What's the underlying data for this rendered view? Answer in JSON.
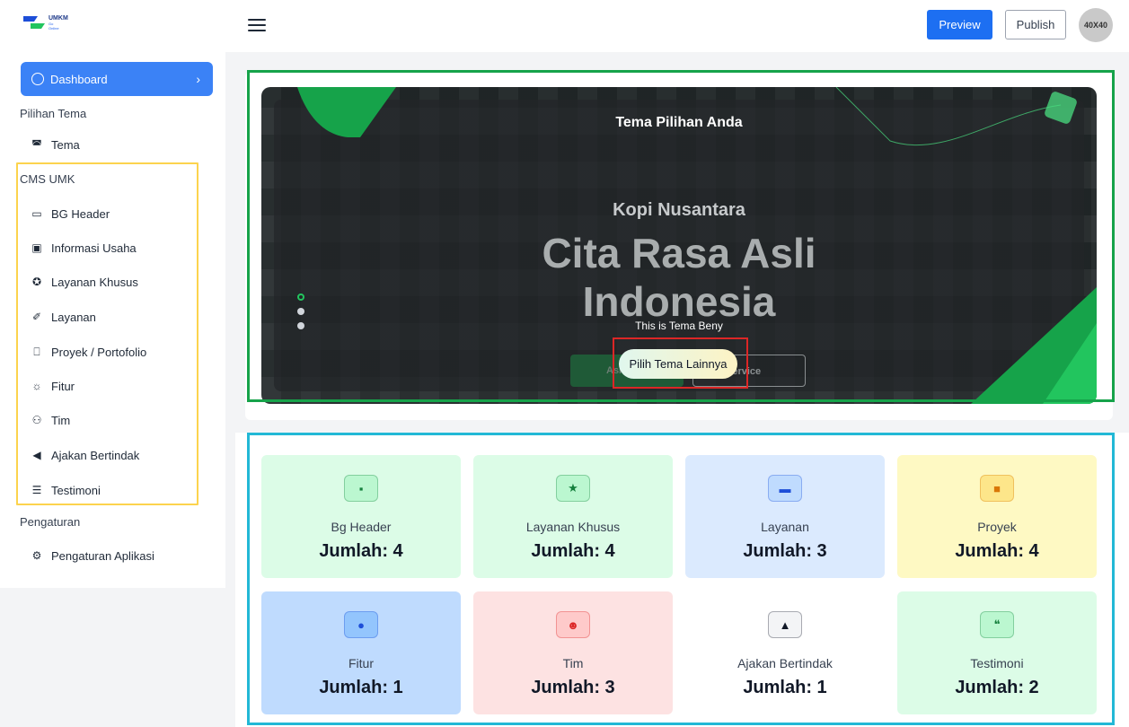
{
  "header": {
    "logo": {
      "line1": "UMKM",
      "line2": "Go",
      "line3": "Online"
    },
    "preview_label": "Preview",
    "publish_label": "Publish",
    "avatar_label": "40X40"
  },
  "sidebar": {
    "dashboard_label": "Dashboard",
    "sections": {
      "pilihan_tema": "Pilihan Tema",
      "cms_umk": "CMS UMK",
      "pengaturan": "Pengaturan"
    },
    "items": [
      {
        "label": "Tema",
        "icon": "palette-icon"
      },
      {
        "label": "BG Header",
        "icon": "image-icon"
      },
      {
        "label": "Informasi Usaha",
        "icon": "info-box-icon"
      },
      {
        "label": "Layanan Khusus",
        "icon": "star-circle-icon"
      },
      {
        "label": "Layanan",
        "icon": "handshake-icon"
      },
      {
        "label": "Proyek / Portofolio",
        "icon": "briefcase-icon"
      },
      {
        "label": "Fitur",
        "icon": "bulb-icon"
      },
      {
        "label": "Tim",
        "icon": "users-icon"
      },
      {
        "label": "Ajakan Bertindak",
        "icon": "megaphone-icon"
      },
      {
        "label": "Testimoni",
        "icon": "chat-icon"
      },
      {
        "label": "Pengaturan Aplikasi",
        "icon": "gear-icon"
      }
    ]
  },
  "hero": {
    "heading": "Tema Pilihan Anda",
    "subheading": "Kopi Nusantara",
    "headline_line1": "Cita Rasa Asli",
    "headline_line2": "Indonesia",
    "note": "This is Tema Beny",
    "button_a": "Ask",
    "button_b": "Service",
    "pick_button": "Pilih Tema Lainnya",
    "colors": {
      "accent": "#16a34a",
      "outline": "#16a34a",
      "highlight": "#dc2626"
    }
  },
  "stats": [
    {
      "label": "Bg Header",
      "count": "Jumlah: 4",
      "icon": "file-icon",
      "bg": "#dcfce7",
      "icon_bg": "#bbf7d0",
      "icon_color": "#15803d"
    },
    {
      "label": "Layanan Khusus",
      "count": "Jumlah: 4",
      "icon": "star-icon",
      "bg": "#dcfce7",
      "icon_bg": "#bbf7d0",
      "icon_color": "#15803d"
    },
    {
      "label": "Layanan",
      "count": "Jumlah: 3",
      "icon": "briefcase-icon",
      "bg": "#dbeafe",
      "icon_bg": "#bfdbfe",
      "icon_color": "#1d4ed8"
    },
    {
      "label": "Proyek",
      "count": "Jumlah: 4",
      "icon": "folder-icon",
      "bg": "#fef9c3",
      "icon_bg": "#fde68a",
      "icon_color": "#d97706"
    },
    {
      "label": "Fitur",
      "count": "Jumlah: 1",
      "icon": "bulb-icon",
      "bg": "#bfdbfe",
      "icon_bg": "#93c5fd",
      "icon_color": "#1d4ed8"
    },
    {
      "label": "Tim",
      "count": "Jumlah: 3",
      "icon": "users-icon",
      "bg": "#fde2e2",
      "icon_bg": "#fecaca",
      "icon_color": "#dc2626"
    },
    {
      "label": "Ajakan Bertindak",
      "count": "Jumlah: 1",
      "icon": "bell-icon",
      "bg": "#ffffff",
      "icon_bg": "#f3f4f6",
      "icon_color": "#111827"
    },
    {
      "label": "Testimoni",
      "count": "Jumlah: 2",
      "icon": "quote-icon",
      "bg": "#dcfce7",
      "icon_bg": "#bbf7d0",
      "icon_color": "#15803d"
    }
  ]
}
